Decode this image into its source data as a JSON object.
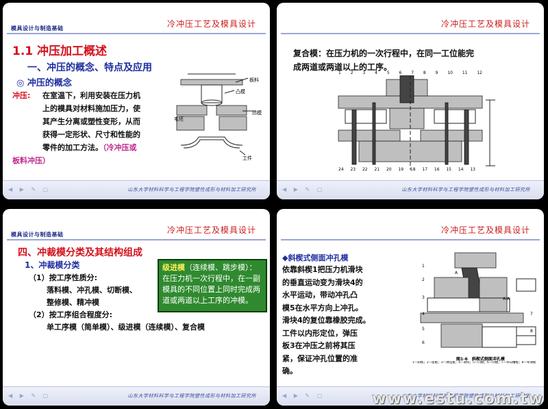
{
  "header": {
    "left": "模具设计与制造基础",
    "right": "冷冲压工艺及模具设计"
  },
  "footer": {
    "org": "山东大学材料科学与工程学院塑性成形与材料加工研究所"
  },
  "slide1": {
    "section": "1.1 冲压加工概述",
    "subsection": "一、冲压的概念、特点及应用",
    "concept": "◎ 冲压的概念",
    "term": "冲压:",
    "lines": [
      "在室温下，利用安装在压力机",
      "上的模具对材料施加压力，使",
      "其产生分离或塑性变形，从而",
      "获得一定形状、尺寸和性能的"
    ],
    "line5_prefix": "零件的加工方法。",
    "line5_note": "（冷冲压或",
    "line6_note": "板料冲压）",
    "fig_labels": {
      "punch": "凸模",
      "blank": "板料",
      "holder": "毛坯",
      "die": "凹模",
      "part": "工件"
    }
  },
  "slide2": {
    "text_line1": "复合模：在压力机的一次行程中，在同一工位能完",
    "text_line2": "成两道或两道以上的工序。",
    "top_numbers": [
      "1",
      "2",
      "3",
      "4",
      "5",
      "6",
      "7",
      "8",
      "9",
      "10",
      "11",
      "12"
    ],
    "bottom_numbers": [
      "24",
      "23",
      "22",
      "21",
      "20",
      "19",
      "18",
      "17",
      "16",
      "15",
      "14",
      "13"
    ]
  },
  "slide3": {
    "section": "四、冲裁模分类及其结构组成",
    "sub": "1、冲裁模分类",
    "item1": "（1）按工序性质分:",
    "item1_a": "落料模、冲孔模、切断模、",
    "item1_b": "整修模、精冲模",
    "item2": "（2）按工序组合程度分:",
    "item2_a": "单工序模（简单模）、级进模（连续模）、复合模",
    "callout_kw": "级进模",
    "callout_rest": "（连续模、跳步模）：在压力机一次行程中，在一副模具的不同位置上同时完成两道或两道以上工序的冲模。"
  },
  "slide4": {
    "title": "◆斜楔式侧面冲孔模",
    "lines": [
      "依靠斜楔1把压力机滑块",
      "的垂直运动变为滑块4的",
      "水平运动，带动冲孔凸",
      "模5在水平方向上冲孔。",
      "滑块4的复位靠橡胶完成。",
      "工件以内形定位，弹压",
      "板3在冲压之前将其压",
      "紧，保证冲孔位置的准",
      "确。"
    ],
    "caption": "图1-6　斜楔式侧面冲孔模",
    "legend": "1—斜楔；2—座板；3—弹压板；4—滑块；5—凸模；6—凹模；7—导向槽板；8—导滑板",
    "marks": [
      "1",
      "2",
      "3",
      "4",
      "5",
      "6",
      "7",
      "8",
      "A",
      "A-A"
    ]
  },
  "watermark": "www.estu.com.tw"
}
